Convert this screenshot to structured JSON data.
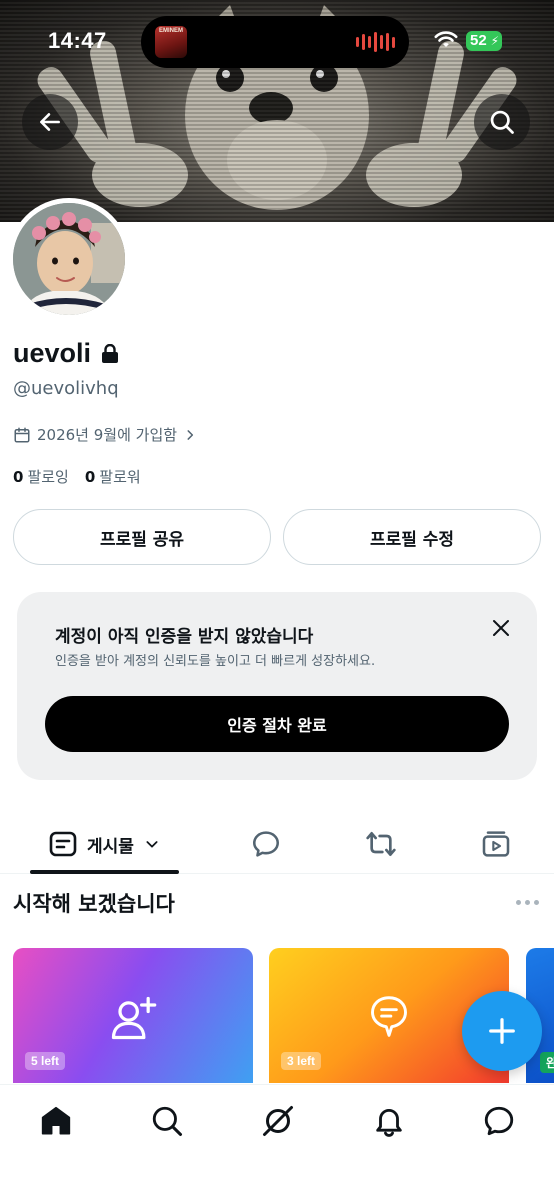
{
  "status_bar": {
    "time": "14:47",
    "now_playing_art_text": "EMINEM",
    "battery": "52"
  },
  "profile": {
    "display_name": "uevoli",
    "handle": "@uevolivhq",
    "joined": "2026년 9월에 가입함",
    "following_count": "0",
    "following_label": "팔로잉",
    "followers_count": "0",
    "followers_label": "팔로워"
  },
  "actions": {
    "share_label": "프로필 공유",
    "edit_label": "프로필 수정"
  },
  "verification": {
    "title": "계정이 아직 인증을 받지 않았습니다",
    "subtitle": "인증을 받아 계정의 신뢰도를 높이고 더 빠르게 성장하세요.",
    "cta_label": "인증 절차 완료"
  },
  "tabs": {
    "posts_label": "게시물"
  },
  "onboarding": {
    "title": "시작해 보겠습니다",
    "cards": [
      {
        "icon": "add-user-icon",
        "badge": "5 left"
      },
      {
        "icon": "compose-bubble-icon",
        "badge": "3 left"
      },
      {
        "icon": "",
        "badge": "완"
      }
    ]
  },
  "colors": {
    "accent": "#1d9bf0",
    "text_primary": "#0f1419",
    "text_secondary": "#536471",
    "battery": "#34c759"
  }
}
